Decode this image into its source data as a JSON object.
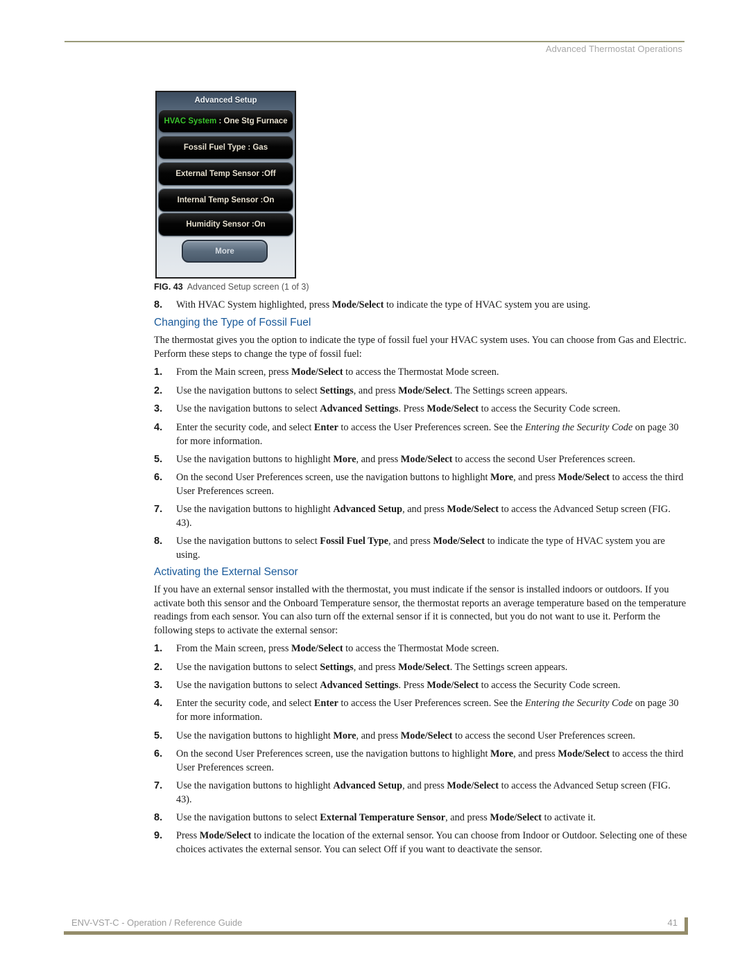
{
  "header": {
    "title": "Advanced Thermostat Operations"
  },
  "figure": {
    "screen_title": "Advanced Setup",
    "rows": [
      {
        "label": "HVAC System",
        "separator": " : ",
        "value": "One Stg Furnace",
        "highlighted": true
      },
      {
        "label": "Fossil Fuel Type : Gas"
      },
      {
        "label": "External Temp Sensor :Off"
      },
      {
        "label": "Internal Temp Sensor :On"
      },
      {
        "label": "Humidity Sensor :On"
      }
    ],
    "more_button": "More",
    "highlight_color": "#39c22c",
    "caption_label": "FIG. 43",
    "caption_text": "Advanced Setup screen (1 of 3)"
  },
  "intro_step": {
    "num": "8.",
    "parts": [
      "With HVAC System highlighted, press ",
      "Mode/Select",
      " to indicate the type of HVAC system you are using."
    ]
  },
  "section1": {
    "heading": "Changing the Type of Fossil Fuel",
    "paragraph": "The thermostat gives you the option to indicate the type of fossil fuel your HVAC system uses. You can choose from Gas and Electric. Perform these steps to change the type of fossil fuel:",
    "steps": [
      {
        "num": "1.",
        "a": "From the Main screen, press ",
        "b": "Mode/Select",
        "c": " to access the Thermostat Mode screen."
      },
      {
        "num": "2.",
        "a": "Use the navigation buttons to select ",
        "b": "Settings",
        "c": ", and press ",
        "d": "Mode/Select",
        "e": ". The Settings screen appears."
      },
      {
        "num": "3.",
        "a": "Use the navigation buttons to select ",
        "b": "Advanced Settings",
        "c": ". Press ",
        "d": "Mode/Select",
        "e": " to access the Security Code screen."
      },
      {
        "num": "4.",
        "a": "Enter the security code, and select ",
        "b": "Enter",
        "c": " to access the User Preferences screen. See the ",
        "i": "Entering the Security Code",
        "e": " on page 30 for more information."
      },
      {
        "num": "5.",
        "a": "Use the navigation buttons to highlight ",
        "b": "More",
        "c": ", and press ",
        "d": "Mode/Select",
        "e": " to access the second User Preferences screen."
      },
      {
        "num": "6.",
        "a": "On the second User Preferences screen, use the navigation buttons to highlight ",
        "b": "More",
        "c": ", and press ",
        "d": "Mode/Select",
        "e": " to access the third User Preferences screen."
      },
      {
        "num": "7.",
        "a": "Use the navigation buttons to highlight ",
        "b": "Advanced Setup",
        "c": ", and press ",
        "d": "Mode/Select",
        "e": " to access the Advanced Setup screen (FIG. 43)."
      },
      {
        "num": "8.",
        "a": "Use the navigation buttons to select ",
        "b": "Fossil Fuel Type",
        "c": ", and press ",
        "d": "Mode/Select",
        "e": " to indicate the type of HVAC system you are using."
      }
    ]
  },
  "section2": {
    "heading": "Activating the External Sensor",
    "paragraph": "If you have an external sensor installed with the thermostat, you must indicate if the sensor is installed indoors or outdoors. If you activate both this sensor and the Onboard Temperature sensor, the thermostat reports an average temperature based on the temperature readings from each sensor. You can also turn off the external sensor if it is connected, but you do not want to use it. Perform the following steps to activate the external sensor:",
    "steps": [
      {
        "num": "1.",
        "a": "From the Main screen, press ",
        "b": "Mode/Select",
        "c": " to access the Thermostat Mode screen."
      },
      {
        "num": "2.",
        "a": "Use the navigation buttons to select ",
        "b": "Settings",
        "c": ", and press ",
        "d": "Mode/Select",
        "e": ". The Settings screen appears."
      },
      {
        "num": "3.",
        "a": "Use the navigation buttons to select ",
        "b": "Advanced Settings",
        "c": ". Press ",
        "d": "Mode/Select",
        "e": " to access the Security Code screen."
      },
      {
        "num": "4.",
        "a": "Enter the security code, and select ",
        "b": "Enter",
        "c": " to access the User Preferences screen. See the ",
        "i": "Entering the Security Code",
        "e": " on page 30 for more information."
      },
      {
        "num": "5.",
        "a": "Use the navigation buttons to highlight ",
        "b": "More",
        "c": ", and press ",
        "d": "Mode/Select",
        "e": " to access the second User Preferences screen."
      },
      {
        "num": "6.",
        "a": "On the second User Preferences screen, use the navigation buttons to highlight ",
        "b": "More",
        "c": ", and press ",
        "d": "Mode/Select",
        "e": " to access the third User Preferences screen."
      },
      {
        "num": "7.",
        "a": "Use the navigation buttons to highlight ",
        "b": "Advanced Setup",
        "c": ", and press ",
        "d": "Mode/Select",
        "e": " to access the Advanced Setup screen (FIG. 43)."
      },
      {
        "num": "8.",
        "a": "Use the navigation buttons to select ",
        "b": "External Temperature Sensor",
        "c": ", and press ",
        "d": "Mode/Select",
        "e": " to activate it."
      },
      {
        "num": "9.",
        "a": "Press ",
        "b": "Mode/Select",
        "c": " to indicate the location of the external sensor. You can choose from Indoor or Outdoor. Selecting one of these choices activates the external sensor. You can select Off if you want to deactivate the sensor."
      }
    ]
  },
  "footer": {
    "title": "ENV-VST-C - Operation / Reference Guide",
    "page": "41"
  },
  "colors": {
    "heading": "#1a5a9a",
    "rule": "#948c6a"
  }
}
